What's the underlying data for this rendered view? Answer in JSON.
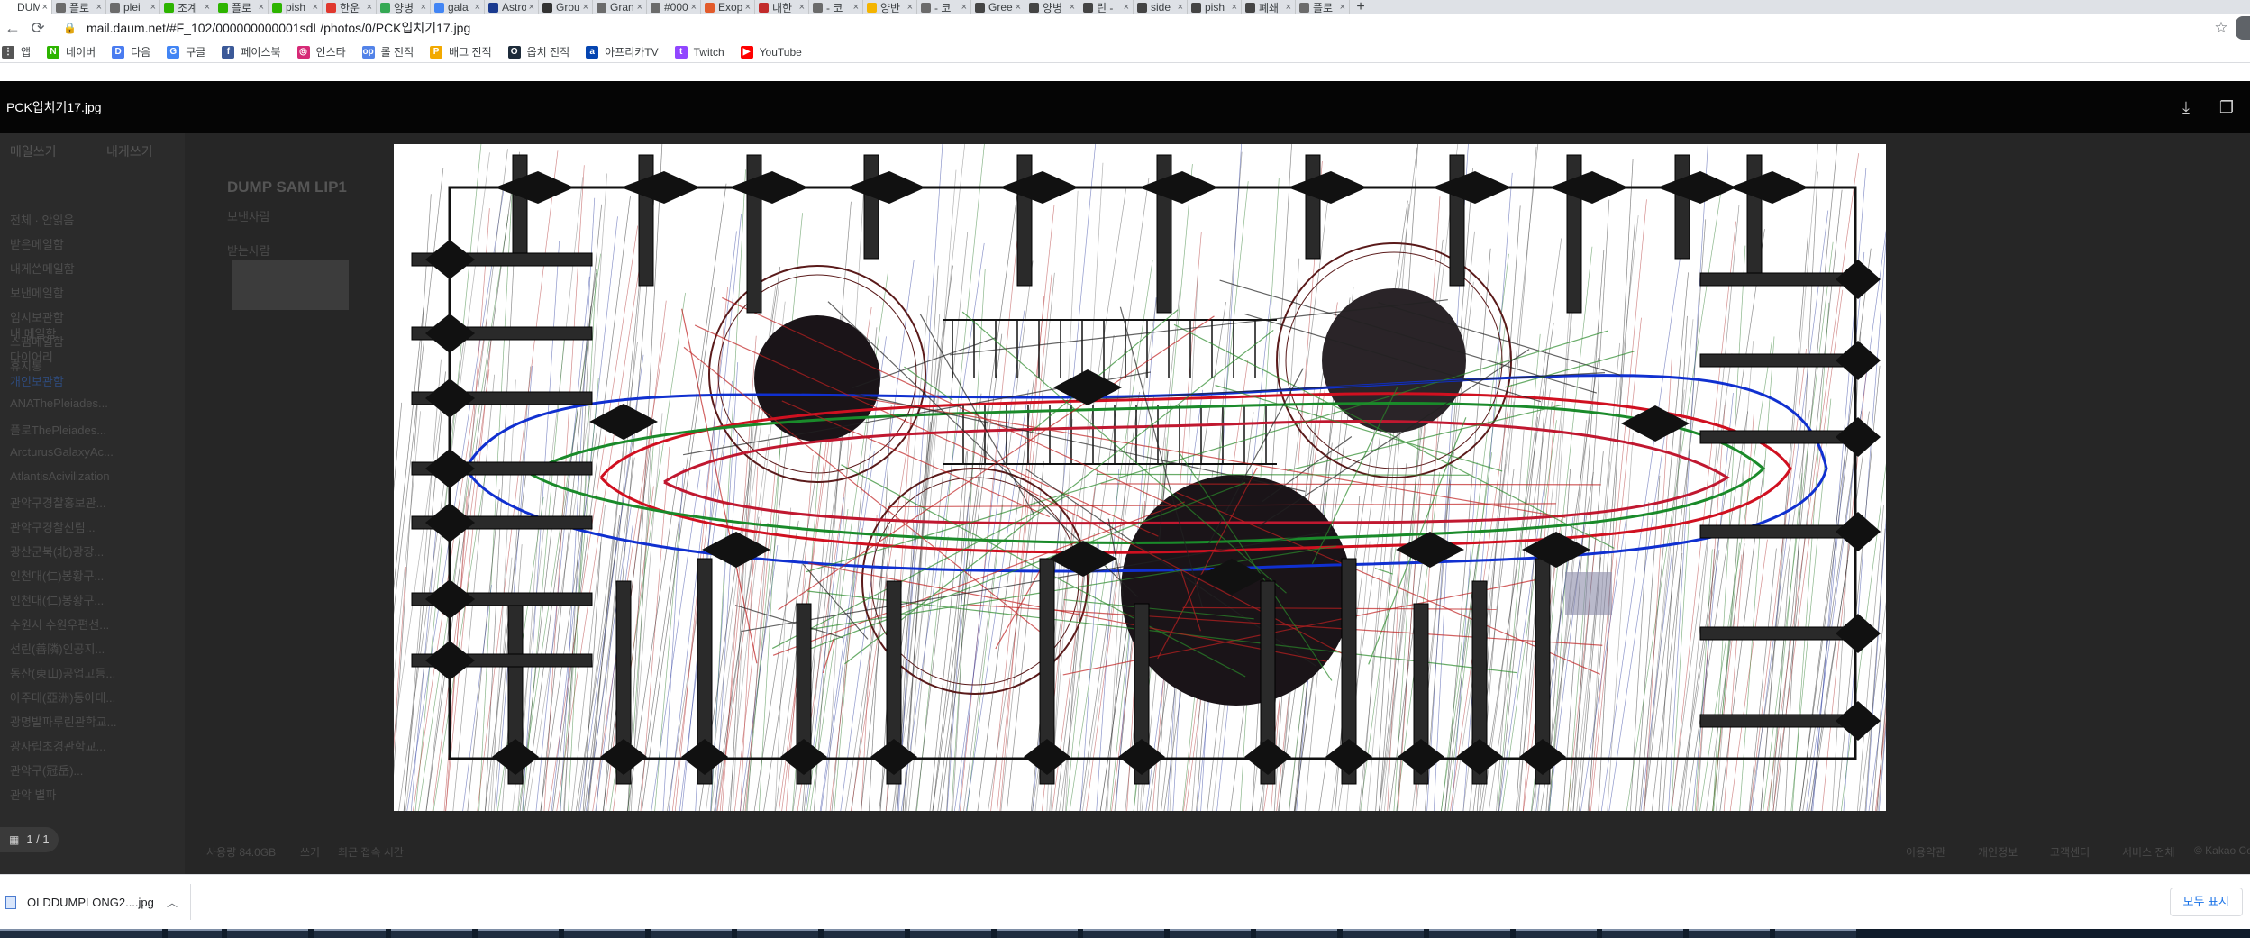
{
  "browser": {
    "tabs": [
      {
        "label": "DUM",
        "icon": "daum-icon",
        "color": "#ffffff",
        "active": true
      },
      {
        "label": "플로",
        "icon": "web-icon",
        "color": "#6b6b6b"
      },
      {
        "label": "plei",
        "icon": "web-icon",
        "color": "#6b6b6b"
      },
      {
        "label": "조계",
        "icon": "green-icon",
        "color": "#2db400"
      },
      {
        "label": "플로",
        "icon": "naver-icon",
        "color": "#2db400"
      },
      {
        "label": "pish",
        "icon": "naver-icon",
        "color": "#2db400"
      },
      {
        "label": "한운",
        "icon": "red-icon",
        "color": "#e0382e"
      },
      {
        "label": "양병",
        "icon": "maps-icon",
        "color": "#34a853"
      },
      {
        "label": "gala",
        "icon": "google-icon",
        "color": "#4285f4"
      },
      {
        "label": "Astro",
        "icon": "nasa-icon",
        "color": "#1a3a8f"
      },
      {
        "label": "Grou",
        "icon": "sheet-icon",
        "color": "#333333"
      },
      {
        "label": "Gran",
        "icon": "web-icon",
        "color": "#6b6b6b"
      },
      {
        "label": "#000",
        "icon": "web-icon",
        "color": "#6b6b6b"
      },
      {
        "label": "Exop",
        "icon": "red-icon",
        "color": "#e25b2b"
      },
      {
        "label": "내한",
        "icon": "wave-icon",
        "color": "#c22b2b"
      },
      {
        "label": "- 코",
        "icon": "web-icon",
        "color": "#6b6b6b"
      },
      {
        "label": "양반",
        "icon": "doc-icon",
        "color": "#f4b400"
      },
      {
        "label": "- 코",
        "icon": "web-icon",
        "color": "#6b6b6b"
      },
      {
        "label": "Gree",
        "icon": "wiki-icon",
        "color": "#444444"
      },
      {
        "label": "양병",
        "icon": "wiki-icon",
        "color": "#444444"
      },
      {
        "label": "린 -",
        "icon": "wiki-icon",
        "color": "#444444"
      },
      {
        "label": "side",
        "icon": "wiki-icon",
        "color": "#444444"
      },
      {
        "label": "pish",
        "icon": "wiki-icon",
        "color": "#444444"
      },
      {
        "label": "폐쇄",
        "icon": "wiki-icon",
        "color": "#444444"
      },
      {
        "label": "플로",
        "icon": "web-icon",
        "color": "#6b6b6b"
      }
    ],
    "new_tab": "+",
    "close_glyph": "×",
    "url": "mail.daum.net/#F_102/000000000001sdL/photos/0/PCK입치기17.jpg",
    "bookmarks": [
      {
        "label": "앱",
        "icon": "apps-icon",
        "color": "#555555",
        "glyph": "⋮"
      },
      {
        "label": "네이버",
        "icon": "naver-icon",
        "color": "#2db400",
        "glyph": "N"
      },
      {
        "label": "다음",
        "icon": "daum-icon",
        "color": "#4a7cf0",
        "glyph": "D"
      },
      {
        "label": "구글",
        "icon": "google-icon",
        "color": "#4285f4",
        "glyph": "G"
      },
      {
        "label": "페이스북",
        "icon": "facebook-icon",
        "color": "#3b5998",
        "glyph": "f"
      },
      {
        "label": "인스타",
        "icon": "instagram-icon",
        "color": "#d62976",
        "glyph": "◎"
      },
      {
        "label": "롤 전적",
        "icon": "op-gg-icon",
        "color": "#5383e8",
        "glyph": "op"
      },
      {
        "label": "배그 전적",
        "icon": "pubg-icon",
        "color": "#f2a900",
        "glyph": "P"
      },
      {
        "label": "옵치 전적",
        "icon": "overwatch-icon",
        "color": "#1d2b3a",
        "glyph": "O"
      },
      {
        "label": "아프리카TV",
        "icon": "afreecatv-icon",
        "color": "#0545b1",
        "glyph": "a"
      },
      {
        "label": "Twitch",
        "icon": "twitch-icon",
        "color": "#9146ff",
        "glyph": "t"
      },
      {
        "label": "YouTube",
        "icon": "youtube-icon",
        "color": "#ff0000",
        "glyph": "▶"
      }
    ]
  },
  "viewer": {
    "title": "PCK입치기17.jpg",
    "counter": "1 / 1",
    "download_icon": "download-icon",
    "fullscreen_icon": "fullscreen-icon"
  },
  "mail": {
    "write": "메일쓰기",
    "self": "내게쓰기",
    "subject": "DUMP SAM LIP1",
    "folders_header": "전체 · 안읽음",
    "folders": [
      "받은메일함",
      "내게쓴메일함",
      "보낸메일함",
      "임시보관함",
      "스팸메일함",
      "휴지통"
    ],
    "my_folders": "내 메일함",
    "my_folder_items": [
      "다이어리",
      "개인보관함",
      "ANAThePleiades...",
      "플로ThePleiades...",
      "ArcturusGalaxyAc...",
      "AtlantisAcivilization",
      "관악구경찰홍보관...",
      "관악구경찰신림...",
      "광산군북(北)광장...",
      "인천대(仁)봉황구...",
      "인천대(仁)봉황구...",
      "수원시 수원우편선...",
      "선린(善隣)인공지...",
      "동산(東山)공업고등...",
      "아주대(亞洲)동아대...",
      "광명발파루린관학교...",
      "광사립초경관학교...",
      "관악구(冠岳)...",
      "관악 별파"
    ],
    "status": [
      "보낸사람",
      "받는사람"
    ],
    "footer": [
      "사용량 84.0GB",
      "쓰기",
      "최근 접속 시간"
    ],
    "footer_right": [
      "이용약관",
      "개인정보",
      "고객센터",
      "서비스 전체",
      "© Kakao Corp."
    ]
  },
  "shelf": {
    "file": "OLDDUMPLONG2....jpg",
    "show_all": "모두 표시"
  }
}
